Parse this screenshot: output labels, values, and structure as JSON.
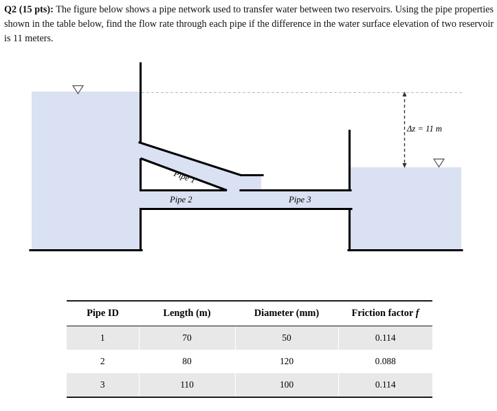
{
  "question": {
    "label": "Q2 (15 pts):",
    "body": " The figure below shows a pipe network used to transfer water between two reservoirs. Using the pipe properties shown in the table below, find the flow rate through each pipe if the difference in the water surface elevation of two reservoir is 11 meters."
  },
  "figure": {
    "labels": {
      "pipe1": "Pipe 1",
      "pipe2": "Pipe 2",
      "pipe3": "Pipe 3",
      "elevation_difference": "Δz = 11 m"
    },
    "water_surface_marker": "▽",
    "colors": {
      "water_fill": "#d9e1f2",
      "outline": "#000000",
      "datum_dash": "#b9b9b9",
      "dimension_line": "#333333"
    }
  },
  "table": {
    "columns": [
      {
        "label": "Pipe ID"
      },
      {
        "label": "Length (m)"
      },
      {
        "label": "Diameter (mm)"
      },
      {
        "label_prefix": "Friction factor ",
        "label_italic": "f"
      }
    ],
    "rows": [
      {
        "id": "1",
        "length": "70",
        "diameter": "50",
        "friction": "0.114",
        "shaded": true
      },
      {
        "id": "2",
        "length": "80",
        "diameter": "120",
        "friction": "0.088",
        "shaded": false
      },
      {
        "id": "3",
        "length": "110",
        "diameter": "100",
        "friction": "0.114",
        "shaded": true
      }
    ]
  }
}
